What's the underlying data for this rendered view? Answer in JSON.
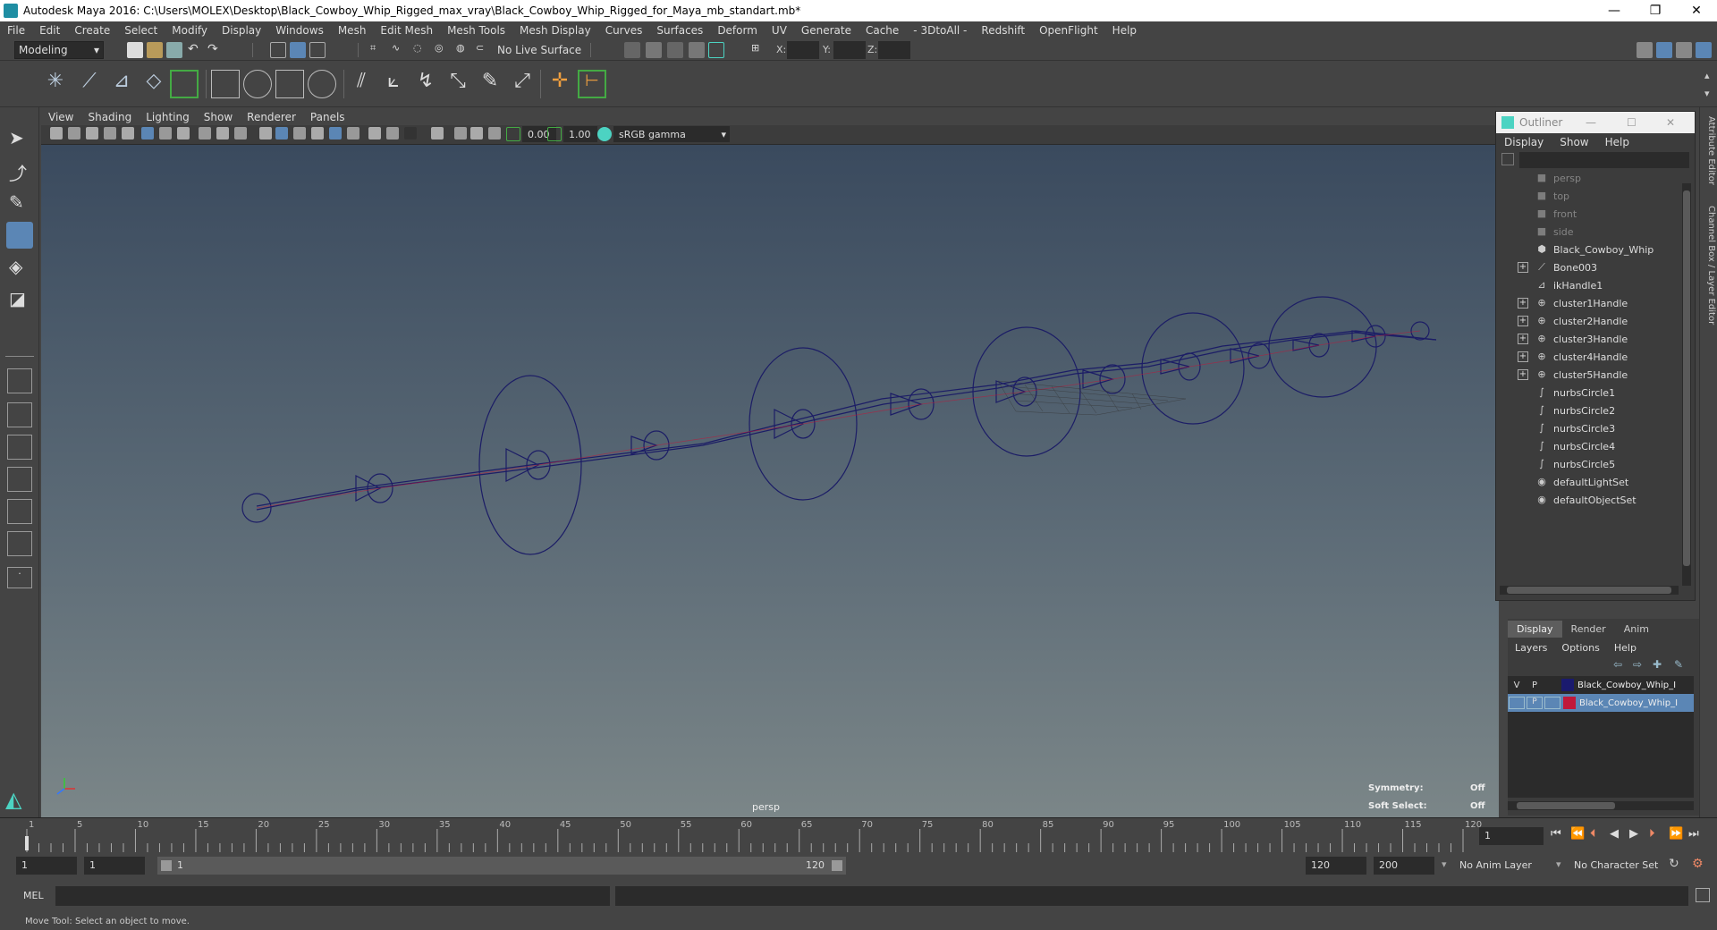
{
  "window": {
    "title": "Autodesk Maya 2016: C:\\Users\\MOLEX\\Desktop\\Black_Cowboy_Whip_Rigged_max_vray\\Black_Cowboy_Whip_Rigged_for_Maya_mb_standart.mb*",
    "minimize": "—",
    "restore": "❐",
    "close": "✕"
  },
  "menubar": [
    "File",
    "Edit",
    "Create",
    "Select",
    "Modify",
    "Display",
    "Windows",
    "Mesh",
    "Edit Mesh",
    "Mesh Tools",
    "Mesh Display",
    "Curves",
    "Surfaces",
    "Deform",
    "UV",
    "Generate",
    "Cache",
    "- 3DtoAll -",
    "Redshift",
    "OpenFlight",
    "Help"
  ],
  "statusline": {
    "mode": "Modeling",
    "live_surface": "No Live Surface",
    "x_label": "X:",
    "y_label": "Y:",
    "z_label": "Z:"
  },
  "viewport": {
    "menus": [
      "View",
      "Shading",
      "Lighting",
      "Show",
      "Renderer",
      "Panels"
    ],
    "exposure": "0.00",
    "gamma": "1.00",
    "color_space": "sRGB gamma",
    "camera_label": "persp",
    "symmetry_label": "Symmetry:",
    "symmetry_value": "Off",
    "soft_select_label": "Soft Select:",
    "soft_select_value": "Off"
  },
  "outliner": {
    "title": "Outliner",
    "menus": [
      "Display",
      "Show",
      "Help"
    ],
    "items": [
      {
        "label": "persp",
        "icon": "camera-icon",
        "expandable": false,
        "dim": true
      },
      {
        "label": "top",
        "icon": "camera-icon",
        "expandable": false,
        "dim": true
      },
      {
        "label": "front",
        "icon": "camera-icon",
        "expandable": false,
        "dim": true
      },
      {
        "label": "side",
        "icon": "camera-icon",
        "expandable": false,
        "dim": true
      },
      {
        "label": "Black_Cowboy_Whip",
        "icon": "mesh-icon",
        "expandable": false,
        "dim": false
      },
      {
        "label": "Bone003",
        "icon": "joint-icon",
        "expandable": true,
        "dim": false
      },
      {
        "label": "ikHandle1",
        "icon": "ik-handle-icon",
        "expandable": false,
        "dim": false
      },
      {
        "label": "cluster1Handle",
        "icon": "cluster-icon",
        "expandable": true,
        "dim": false
      },
      {
        "label": "cluster2Handle",
        "icon": "cluster-icon",
        "expandable": true,
        "dim": false
      },
      {
        "label": "cluster3Handle",
        "icon": "cluster-icon",
        "expandable": true,
        "dim": false
      },
      {
        "label": "cluster4Handle",
        "icon": "cluster-icon",
        "expandable": true,
        "dim": false
      },
      {
        "label": "cluster5Handle",
        "icon": "cluster-icon",
        "expandable": true,
        "dim": false
      },
      {
        "label": "nurbsCircle1",
        "icon": "curve-icon",
        "expandable": false,
        "dim": false
      },
      {
        "label": "nurbsCircle2",
        "icon": "curve-icon",
        "expandable": false,
        "dim": false
      },
      {
        "label": "nurbsCircle3",
        "icon": "curve-icon",
        "expandable": false,
        "dim": false
      },
      {
        "label": "nurbsCircle4",
        "icon": "curve-icon",
        "expandable": false,
        "dim": false
      },
      {
        "label": "nurbsCircle5",
        "icon": "curve-icon",
        "expandable": false,
        "dim": false
      },
      {
        "label": "defaultLightSet",
        "icon": "set-icon",
        "expandable": false,
        "dim": false
      },
      {
        "label": "defaultObjectSet",
        "icon": "set-icon",
        "expandable": false,
        "dim": false
      }
    ]
  },
  "layers": {
    "tabs": [
      "Display",
      "Render",
      "Anim"
    ],
    "menus": [
      "Layers",
      "Options",
      "Help"
    ],
    "rows": [
      {
        "v": "V",
        "p": "P",
        "color": "#1a1a6e",
        "name": "Black_Cowboy_Whip_I"
      },
      {
        "v": "",
        "p": "P",
        "color": "#c0183a",
        "name": "Black_Cowboy_Whip_I"
      }
    ]
  },
  "rightstrip": {
    "attr": "Attribute Editor",
    "channel": "Channel Box / Layer Editor"
  },
  "timeline": {
    "ticks": [
      "1",
      "5",
      "10",
      "15",
      "20",
      "25",
      "30",
      "35",
      "40",
      "45",
      "50",
      "55",
      "60",
      "65",
      "70",
      "75",
      "80",
      "85",
      "90",
      "95",
      "100",
      "105",
      "110",
      "115",
      "120"
    ],
    "current_frame": "1"
  },
  "range": {
    "start": "1",
    "inner_start": "1",
    "slider_start": "1",
    "slider_end": "120",
    "end": "120",
    "max": "200",
    "anim_layer": "No Anim Layer",
    "char_set": "No Character Set"
  },
  "cmdline": {
    "label": "MEL"
  },
  "helpline": {
    "text": "Move Tool: Select an object to move."
  }
}
